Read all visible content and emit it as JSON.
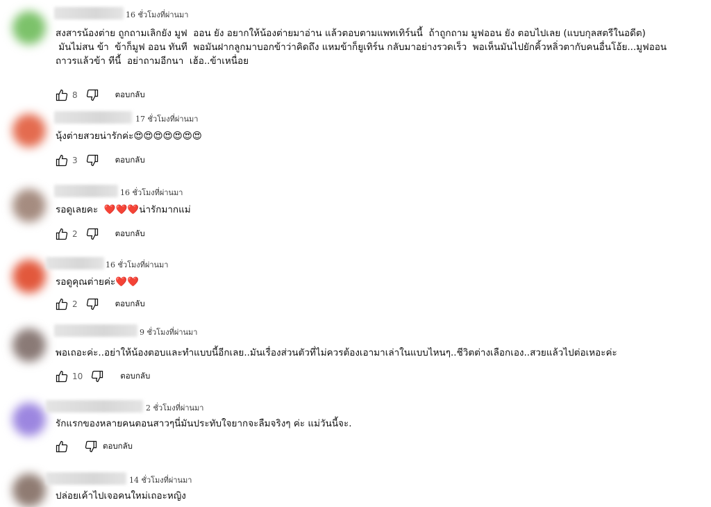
{
  "comments": [
    {
      "timestamp": "16 ชั่วโมงที่ผ่านมา",
      "text": "สงสารน้องต่าย ถูกถามเลิกยัง มูฟ  ออน ยัง อยากให้น้องต่ายมาอ่าน แล้วตอบตามแพทเทิร์นนี้  ถ้าถูกถาม มูฟออน ยัง ตอบไปเลย (แบบกุลสตรีในอดีต)\n มันไม่สน ข้า  ข้าก็มูฟ ออน ทันที  พอมันฝากลูกมาบอกข้าว่าคิดถึง แหมข้าก็ยูเทิร์น กลับมาอย่างรวดเร็ว  พอเห็นมันไปยักคิ้วหลิ่วตากับคนอื่นโอ้ย...มูฟออน\nถาวรแล้วข้า ทีนี้  อย่าถามอีกนา  เฮ้อ..ข้าเหนื่อย",
      "likes": "8",
      "reply_label": "ตอบกลับ",
      "avatar_color": "#7cc26a"
    },
    {
      "timestamp": "17 ชั่วโมงที่ผ่านมา",
      "text": "นุ้งต่ายสวยน่ารักค่ะ😍😍😍😍😍😍😍",
      "likes": "3",
      "reply_label": "ตอบกลับ",
      "avatar_color": "#e46b4f"
    },
    {
      "timestamp": "16 ชั่วโมงที่ผ่านมา",
      "text": "รอดูเลยคะ  ❤️❤️❤️น่ารักมากแม่",
      "likes": "2",
      "reply_label": "ตอบกลับ",
      "avatar_color": "#a58c80"
    },
    {
      "timestamp": "16 ชั่วโมงที่ผ่านมา",
      "text": "รอดูคุณต่ายค่ะ❤️❤️",
      "likes": "2",
      "reply_label": "ตอบกลับ",
      "avatar_color": "#e2583c"
    },
    {
      "timestamp": "9 ชั่วโมงที่ผ่านมา",
      "text": "พอเถอะค่ะ..อย่าให้น้องตอบและทำแบบนี้อีกเลย..มันเรื่องส่วนตัวที่ไม่ควรต้องเอามาเล่าในแบบไหนๆ..ชีวิตต่างเลือกเอง..สวยแล้วไปต่อเหอะค่ะ",
      "likes": "10",
      "reply_label": "ตอบกลับ",
      "avatar_color": "#8a7a76"
    },
    {
      "timestamp": "2 ชั่วโมงที่ผ่านมา",
      "text": "รักแรกของหลายคนตอนสาวๆนี่มันประทับใจยากจะลืมจริงๆ ค่ะ แม่วันนี้จะ.",
      "likes": "",
      "reply_label": "ตอบกลับ",
      "avatar_color": "#9c86e0"
    },
    {
      "timestamp": "14 ชั่วโมงที่ผ่านมา",
      "text": "ปล่อยเค้าไปเจอคนใหม่เถอะหญิง",
      "likes": "",
      "reply_label": "",
      "avatar_color": "#8f7b72"
    }
  ]
}
